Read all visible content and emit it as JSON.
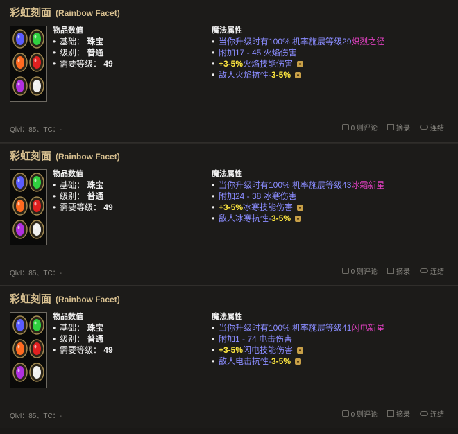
{
  "cards": [
    {
      "title_cn": "彩虹刻面",
      "title_en": "(Rainbow Facet)",
      "stats_header": "物品数值",
      "base_label": "基础：",
      "base_value": "珠宝",
      "grade_label": "级别：",
      "grade_value": "普通",
      "req_label": "需要等级：",
      "req_value": "49",
      "magic_header": "魔法属性",
      "m1_text": "当你升级时有100% 机率施展等级29",
      "m1_skill": "炽烈之径",
      "m2_text": "附加17 - 45 火焰伤害",
      "m3_hi": "+3-5%",
      "m3_text": "火焰技能伤害",
      "m4_text": "敌人火焰抗性-",
      "m4_hi": "3-5%",
      "footer": "Qlvl：85、TC：-",
      "comments": "0 则评论",
      "collect": "摘录",
      "link": "连结"
    },
    {
      "title_cn": "彩虹刻面",
      "title_en": "(Rainbow Facet)",
      "stats_header": "物品数值",
      "base_label": "基础：",
      "base_value": "珠宝",
      "grade_label": "级别：",
      "grade_value": "普通",
      "req_label": "需要等级：",
      "req_value": "49",
      "magic_header": "魔法属性",
      "m1_text": "当你升级时有100% 机率施展等级43",
      "m1_skill": "冰霜新星",
      "m2_text": "附加24 - 38 冰寒伤害",
      "m3_hi": "+3-5%",
      "m3_text": "冰寒技能伤害",
      "m4_text": "敌人冰寒抗性-",
      "m4_hi": "3-5%",
      "footer": "Qlvl：85、TC：-",
      "comments": "0 则评论",
      "collect": "摘录",
      "link": "连结"
    },
    {
      "title_cn": "彩虹刻面",
      "title_en": "(Rainbow Facet)",
      "stats_header": "物品数值",
      "base_label": "基础：",
      "base_value": "珠宝",
      "grade_label": "级别：",
      "grade_value": "普通",
      "req_label": "需要等级：",
      "req_value": "49",
      "magic_header": "魔法属性",
      "m1_text": "当你升级时有100% 机率施展等级41",
      "m1_skill": "闪电新星",
      "m2_text": "附加1 - 74 电击伤害",
      "m3_hi": "+3-5%",
      "m3_text": "闪电技能伤害",
      "m4_text": "敌人电击抗性-",
      "m4_hi": "3-5%",
      "footer": "Qlvl：85、TC：-",
      "comments": "0 则评论",
      "collect": "摘录",
      "link": "连结"
    }
  ],
  "colors": {
    "title": "#d8c090",
    "magic": "#8a8cff",
    "skill": "#e040c0",
    "highlight": "#ffe840",
    "gem_colors": [
      "#5a5cff",
      "#30d040",
      "#ff6a20",
      "#e02020",
      "#b030e0",
      "#f0f0f0"
    ]
  },
  "icons": {
    "comment": "comment-icon",
    "collect": "clip-icon",
    "link": "link-icon",
    "die": "dice-icon"
  }
}
